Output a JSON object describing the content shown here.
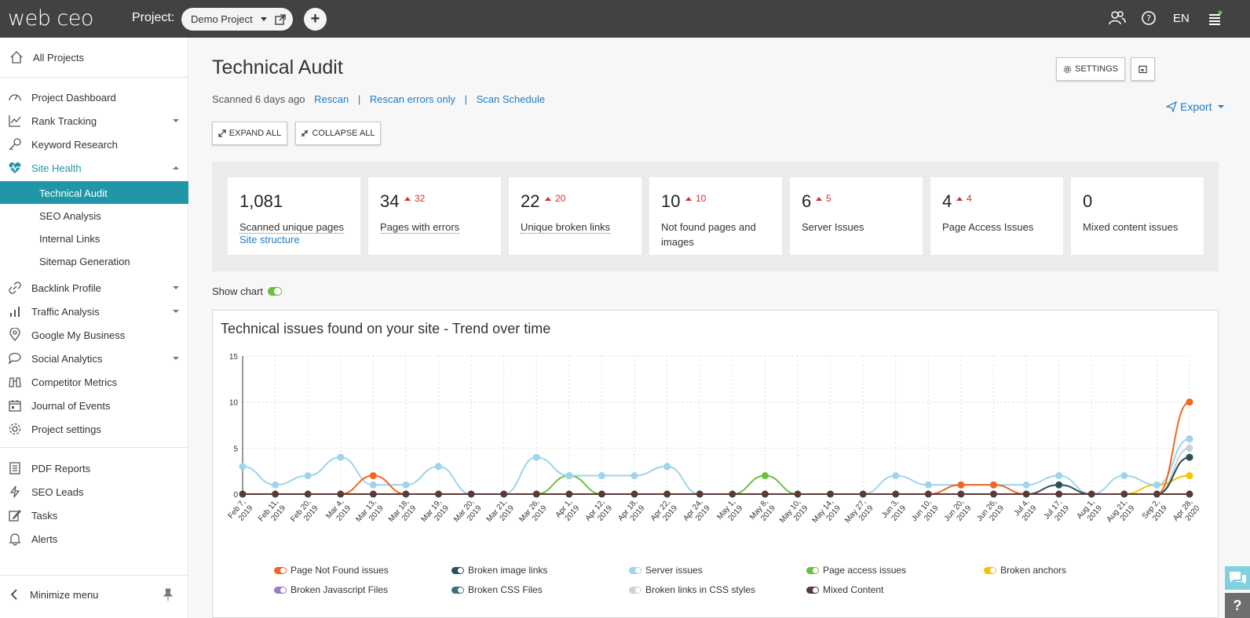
{
  "header": {
    "logo": "web ceo",
    "project_label": "Project:",
    "project_name": "Demo Project",
    "lang": "EN"
  },
  "sidebar": {
    "all_projects": "All Projects",
    "items": [
      {
        "label": "Project Dashboard",
        "icon": "dashboard-icon"
      },
      {
        "label": "Rank Tracking",
        "icon": "chart-line-icon"
      },
      {
        "label": "Keyword Research",
        "icon": "key-icon"
      },
      {
        "label": "Site Health",
        "icon": "heartbeat-icon"
      },
      {
        "label": "Backlink Profile",
        "icon": "link-icon"
      },
      {
        "label": "Traffic Analysis",
        "icon": "bar-chart-icon"
      },
      {
        "label": "Google My Business",
        "icon": "map-pin-icon"
      },
      {
        "label": "Social Analytics",
        "icon": "speech-bubble-icon"
      },
      {
        "label": "Competitor Metrics",
        "icon": "binoculars-icon"
      },
      {
        "label": "Journal of Events",
        "icon": "calendar-icon"
      },
      {
        "label": "Project settings",
        "icon": "gear-icon"
      }
    ],
    "sub_items": [
      "Technical Audit",
      "SEO Analysis",
      "Internal Links",
      "Sitemap Generation"
    ],
    "bottom_items": [
      {
        "label": "PDF Reports",
        "icon": "report-icon"
      },
      {
        "label": "SEO Leads",
        "icon": "bolt-icon"
      },
      {
        "label": "Tasks",
        "icon": "edit-icon"
      },
      {
        "label": "Alerts",
        "icon": "bell-icon"
      }
    ],
    "minimize": "Minimize menu"
  },
  "main": {
    "title": "Technical Audit",
    "scanned": "Scanned 6 days ago",
    "rescan": "Rescan",
    "rescan_errors": "Rescan errors only",
    "scan_schedule": "Scan Schedule",
    "expand_all": "EXPAND ALL",
    "collapse_all": "COLLAPSE ALL",
    "settings": "SETTINGS",
    "export": "Export",
    "show_chart": "Show chart"
  },
  "stats": [
    {
      "value": "1,081",
      "delta": "",
      "label": "Scanned unique pages",
      "link": "Site structure"
    },
    {
      "value": "34",
      "delta": "32",
      "label": "Pages with errors",
      "link": ""
    },
    {
      "value": "22",
      "delta": "20",
      "label": "Unique broken links",
      "link": ""
    },
    {
      "value": "10",
      "delta": "10",
      "label": "Not found pages and images",
      "link": ""
    },
    {
      "value": "6",
      "delta": "5",
      "label": "Server Issues",
      "link": ""
    },
    {
      "value": "4",
      "delta": "4",
      "label": "Page Access Issues",
      "link": ""
    },
    {
      "value": "0",
      "delta": "",
      "label": "Mixed content issues",
      "link": ""
    }
  ],
  "chart_data": {
    "type": "line",
    "title": "Technical issues found on your site - Trend over time",
    "ylim": [
      0,
      15
    ],
    "yticks": [
      0,
      5,
      10,
      15
    ],
    "grid": true,
    "legend_position": "bottom",
    "categories": [
      "Feb 7, 2019",
      "Feb 11, 2019",
      "Feb 20, 2019",
      "Mar 4, 2019",
      "Mar 13, 2019",
      "Mar 18, 2019",
      "Mar 19, 2019",
      "Mar 20, 2019",
      "Mar 21, 2019",
      "Mar 26, 2019",
      "Apr 1, 2019",
      "Apr 12, 2019",
      "Apr 18, 2019",
      "Apr 22, 2019",
      "Apr 24, 2019",
      "May 1, 2019",
      "May 8, 2019",
      "May 10, 2019",
      "May 14, 2019",
      "May 27, 2019",
      "Jun 3, 2019",
      "Jun 10, 2019",
      "Jun 20, 2019",
      "Jun 26, 2019",
      "Jul 4, 2019",
      "Jul 17, 2019",
      "Aug 1, 2019",
      "Aug 21, 2019",
      "Sep 2, 2019",
      "Apr 28, 2020"
    ],
    "series": [
      {
        "name": "Page Not Found issues",
        "color": "#f26522",
        "values": [
          0,
          0,
          0,
          0,
          2,
          0,
          0,
          0,
          0,
          0,
          0,
          0,
          0,
          0,
          0,
          0,
          0,
          0,
          0,
          0,
          0,
          0,
          1,
          1,
          0,
          0,
          0,
          0,
          0,
          10
        ]
      },
      {
        "name": "Broken image links",
        "color": "#2d4f5a",
        "values": [
          0,
          0,
          0,
          0,
          0,
          0,
          0,
          0,
          0,
          0,
          0,
          0,
          0,
          0,
          0,
          0,
          0,
          0,
          0,
          0,
          0,
          0,
          0,
          0,
          0,
          1,
          0,
          0,
          0,
          4
        ]
      },
      {
        "name": "Server issues",
        "color": "#9fd4ec",
        "values": [
          3,
          1,
          2,
          4,
          1,
          1,
          3,
          0,
          0,
          4,
          2,
          2,
          2,
          3,
          0,
          0,
          0,
          0,
          0,
          0,
          2,
          1,
          1,
          1,
          1,
          2,
          0,
          2,
          1,
          6
        ]
      },
      {
        "name": "Page access issues",
        "color": "#6bbf3f",
        "values": [
          0,
          0,
          0,
          0,
          0,
          0,
          0,
          0,
          0,
          0,
          2,
          0,
          0,
          0,
          0,
          0,
          2,
          0,
          0,
          0,
          0,
          0,
          0,
          0,
          0,
          0,
          0,
          0,
          0,
          4
        ]
      },
      {
        "name": "Broken anchors",
        "color": "#f5c400",
        "values": [
          0,
          0,
          0,
          0,
          0,
          0,
          0,
          0,
          0,
          0,
          0,
          0,
          0,
          0,
          0,
          0,
          0,
          0,
          0,
          0,
          0,
          0,
          0,
          0,
          0,
          0,
          0,
          0,
          1,
          2
        ]
      },
      {
        "name": "Broken Javascript Files",
        "color": "#9b7bc9",
        "values": [
          0,
          0,
          0,
          0,
          0,
          0,
          0,
          0,
          0,
          0,
          0,
          0,
          0,
          0,
          0,
          0,
          0,
          0,
          0,
          0,
          0,
          0,
          0,
          0,
          0,
          0,
          0,
          0,
          0,
          0
        ]
      },
      {
        "name": "Broken CSS Files",
        "color": "#3f6e7a",
        "values": [
          0,
          0,
          0,
          0,
          0,
          0,
          0,
          0,
          0,
          0,
          0,
          0,
          0,
          0,
          0,
          0,
          0,
          0,
          0,
          0,
          0,
          0,
          0,
          0,
          0,
          0,
          0,
          0,
          0,
          0
        ]
      },
      {
        "name": "Broken links in CSS styles",
        "color": "#c8d2d8",
        "values": [
          0,
          0,
          0,
          0,
          0,
          0,
          0,
          0,
          0,
          0,
          0,
          0,
          0,
          0,
          0,
          0,
          0,
          0,
          0,
          0,
          0,
          0,
          0,
          0,
          0,
          0,
          0,
          0,
          0,
          5
        ]
      },
      {
        "name": "Mixed Content",
        "color": "#5a3a36",
        "values": [
          0,
          0,
          0,
          0,
          0,
          0,
          0,
          0,
          0,
          0,
          0,
          0,
          0,
          0,
          0,
          0,
          0,
          0,
          0,
          0,
          0,
          0,
          0,
          0,
          0,
          0,
          0,
          0,
          0,
          0
        ]
      }
    ]
  }
}
